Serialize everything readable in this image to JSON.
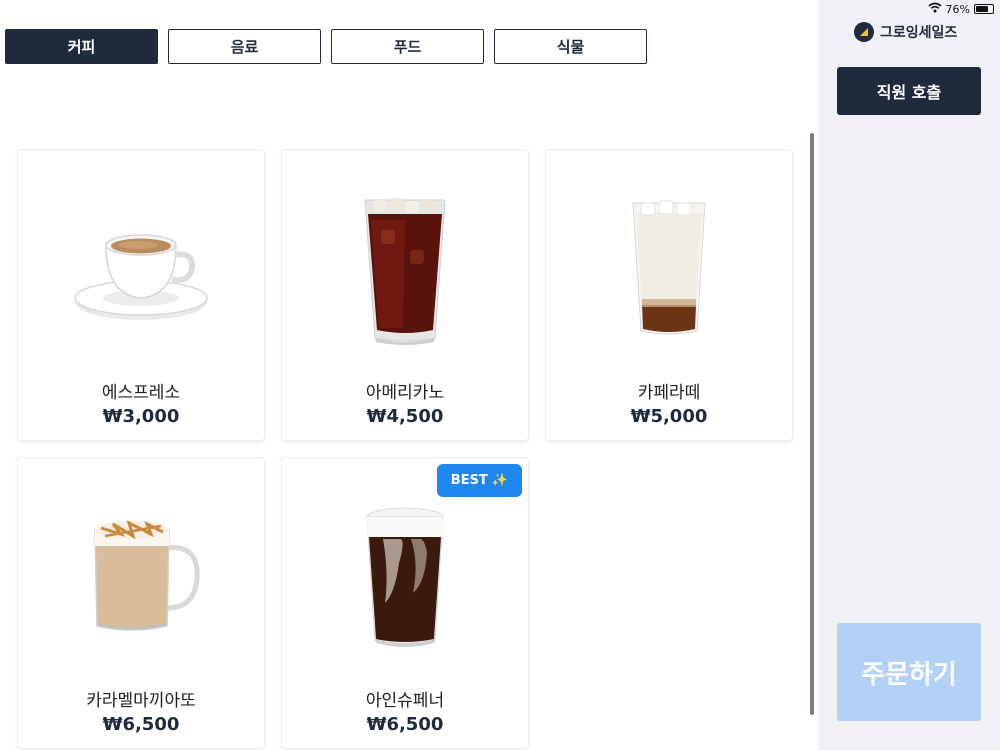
{
  "tabs": [
    {
      "label": "커피",
      "active": true
    },
    {
      "label": "음료",
      "active": false
    },
    {
      "label": "푸드",
      "active": false
    },
    {
      "label": "식물",
      "active": false
    }
  ],
  "products": [
    {
      "name": "에스프레소",
      "price": "₩3,000",
      "image": "espresso-cup-image"
    },
    {
      "name": "아메리카노",
      "price": "₩4,500",
      "image": "iced-americano-image"
    },
    {
      "name": "카페라떼",
      "price": "₩5,000",
      "image": "iced-latte-image"
    },
    {
      "name": "카라멜마끼아또",
      "price": "₩6,500",
      "image": "caramel-macchiato-mug-image"
    },
    {
      "name": "아인슈페너",
      "price": "₩6,500",
      "image": "einspanner-image",
      "badge": "BEST",
      "badge_icon": "✨"
    }
  ],
  "status_bar": {
    "battery": "76%",
    "battery_level": 0.76,
    "icons": [
      "wifi-icon",
      "battery-icon"
    ]
  },
  "sidebar": {
    "brand_name": "그로잉세일즈",
    "call_staff_label": "직원 호출",
    "order_label": "주문하기"
  },
  "colors": {
    "primary": "#1f2a3c",
    "badge": "#1e88f0",
    "order_disabled": "#b3d0f7",
    "sidebar_bg": "#f1f1f5"
  }
}
